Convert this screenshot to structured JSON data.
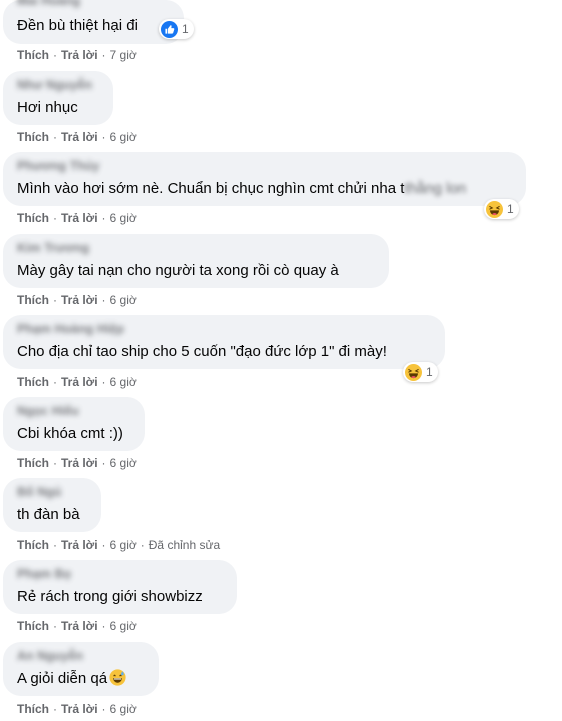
{
  "actions": {
    "like": "Thích",
    "reply": "Trả lời",
    "separator": "·"
  },
  "comments": [
    {
      "author": "Mai Hoàng",
      "text": "Đền bù thiệt hại đi",
      "time": "7 giờ",
      "reaction": {
        "icon": "like-icon",
        "count": "1"
      }
    },
    {
      "author": "Như Nguyễn",
      "text": "Hơi nhục",
      "time": "6 giờ"
    },
    {
      "author": "Phương Thủy",
      "text": "Mình vào hơi sớm nè. Chuẩn bị chục nghìn cmt chửi nha t",
      "text_faded": "thằng lon",
      "time": "6 giờ",
      "reaction": {
        "icon": "haha-icon",
        "count": "1"
      }
    },
    {
      "author": "Kim Trương",
      "text": "Mày gây tai nạn cho người ta xong rồi cò quay à",
      "time": "6 giờ"
    },
    {
      "author": "Phạm Hoàng Hiệp",
      "text": "Cho địa chỉ tao ship cho 5 cuốn \"đạo đức lớp 1\" đi mày!",
      "time": "6 giờ",
      "reaction": {
        "icon": "haha-icon",
        "count": "1"
      }
    },
    {
      "author": "Ngọc Hiếu",
      "text": "Cbi khóa cmt :))",
      "time": "6 giờ"
    },
    {
      "author": "Bố Ngủ",
      "text": "th đàn bà",
      "time": "6 giờ",
      "edited": "Đã chỉnh sửa"
    },
    {
      "author": "Phạm Bọ",
      "text": "Rẻ rách trong giới showbizz",
      "time": "6 giờ"
    },
    {
      "author": "An Nguyễn",
      "text": "A giỏi diễn qá",
      "inline_emoji": "grinning-sweat-icon",
      "time": "6 giờ"
    }
  ]
}
